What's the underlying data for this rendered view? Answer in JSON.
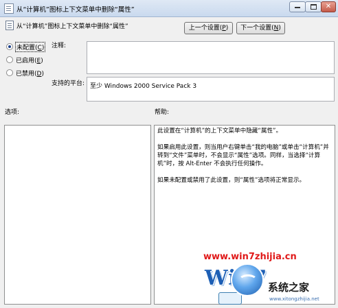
{
  "window": {
    "title": "从“计算机”图标上下文菜单中删除“属性”",
    "controls": {
      "minimize": "minimize-icon",
      "maximize": "maximize-icon",
      "close": "✕"
    }
  },
  "header": {
    "title": "从“计算机”图标上下文菜单中删除“属性”",
    "prev_button": {
      "label": "上一个设置(",
      "key": "P",
      "suffix": ")"
    },
    "next_button": {
      "label": "下一个设置(",
      "key": "N",
      "suffix": ")"
    }
  },
  "state_options": [
    {
      "label": "未配置(",
      "key": "C",
      "suffix": ")",
      "checked": true
    },
    {
      "label": "已启用(",
      "key": "E",
      "suffix": ")",
      "checked": false
    },
    {
      "label": "已禁用(",
      "key": "D",
      "suffix": ")",
      "checked": false
    }
  ],
  "comment": {
    "label": "注释:",
    "value": ""
  },
  "platform": {
    "label": "支持的平台:",
    "value": "至少 Windows 2000 Service Pack 3"
  },
  "options": {
    "label": "选项:"
  },
  "help": {
    "label": "帮助:",
    "paragraphs": [
      "此设置在“计算机”的上下文菜单中隐藏“属性”。",
      "如果启用此设置，则当用户右键单击“我的电脑”或单击“计算机”并转到“文件”菜单时，不会显示“属性”选项。同样，当选择“计算机”时，按 Alt-Enter 不会执行任何操作。",
      "如果未配置或禁用了此设置，则“属性”选项将正常显示。"
    ]
  },
  "watermark": {
    "url": "www.win7zhijia.cn",
    "logo": "Win7",
    "site_name": "系统之家",
    "site_url": "www.xitongzhijia.net",
    "colors": {
      "url": "#e01919",
      "logo": "#1d5fb5"
    }
  }
}
